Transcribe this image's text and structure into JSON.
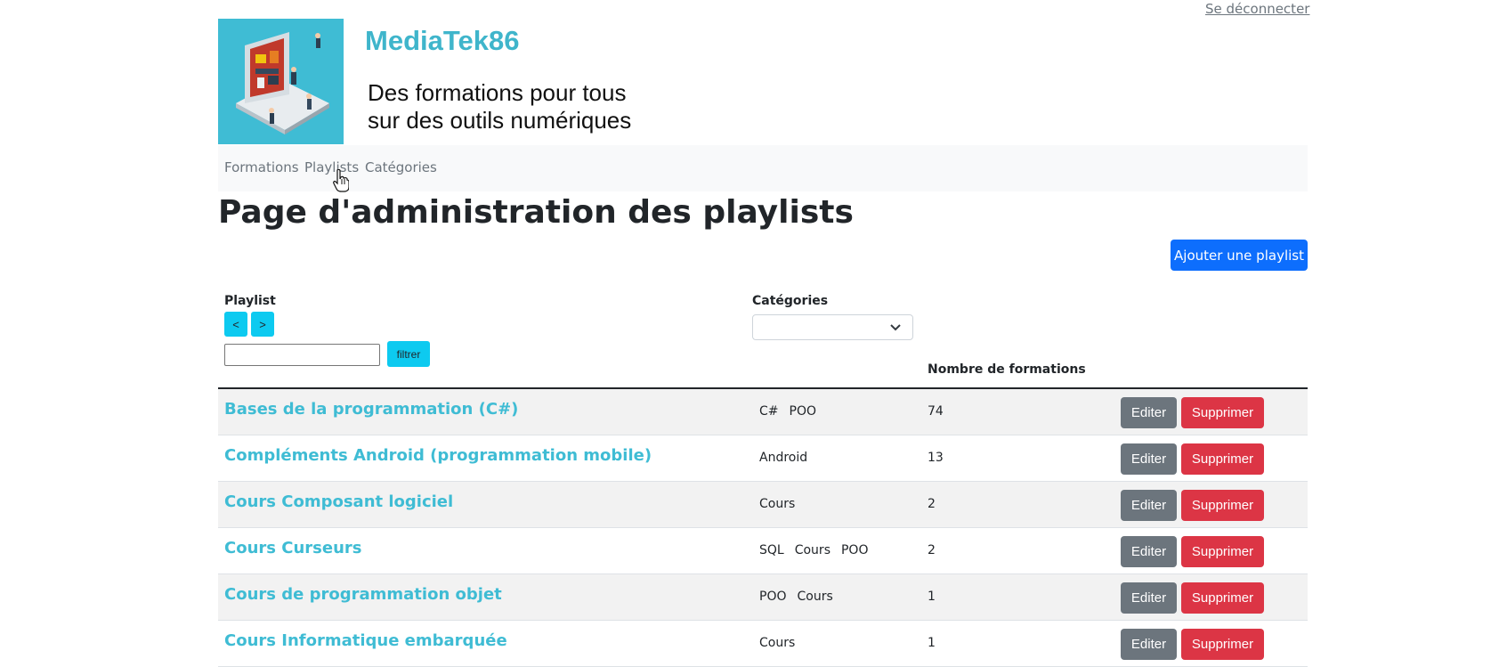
{
  "header": {
    "logout": "Se déconnecter",
    "site_title": "MediaTek86",
    "tagline_line1": "Des formations pour tous",
    "tagline_line2": "sur des outils numériques"
  },
  "nav": {
    "items": [
      {
        "label": "Formations"
      },
      {
        "label": "Playlists"
      },
      {
        "label": "Catégories"
      }
    ]
  },
  "page": {
    "title": "Page d'administration des playlists",
    "add_button": "Ajouter une playlist"
  },
  "table": {
    "col_playlist": "Playlist",
    "sort_asc": "<",
    "sort_desc": ">",
    "filter_value": "",
    "filter_button": "filtrer",
    "col_categories": "Catégories",
    "category_selected": "",
    "col_count": "Nombre de formations",
    "edit_label": "Editer",
    "delete_label": "Supprimer",
    "rows": [
      {
        "name": "Bases de la programmation (C#)",
        "categories": [
          "C#",
          "POO"
        ],
        "count": "74"
      },
      {
        "name": "Compléments Android (programmation mobile)",
        "categories": [
          "Android"
        ],
        "count": "13"
      },
      {
        "name": "Cours Composant logiciel",
        "categories": [
          "Cours"
        ],
        "count": "2"
      },
      {
        "name": "Cours Curseurs",
        "categories": [
          "SQL",
          "Cours",
          "POO"
        ],
        "count": "2"
      },
      {
        "name": "Cours de programmation objet",
        "categories": [
          "POO",
          "Cours"
        ],
        "count": "1"
      },
      {
        "name": "Cours Informatique embarquée",
        "categories": [
          "Cours"
        ],
        "count": "1"
      }
    ]
  },
  "colors": {
    "accent": "#3fbcd4",
    "primary": "#0d6efd",
    "info": "#0dcaf0",
    "secondary": "#6c757d",
    "danger": "#dc3545"
  }
}
